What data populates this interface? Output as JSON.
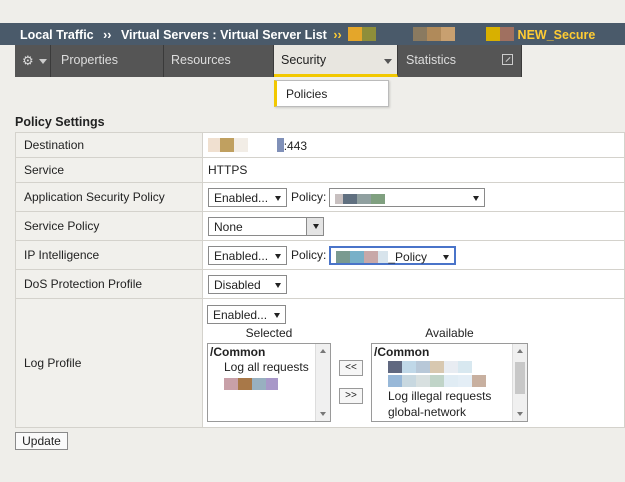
{
  "breadcrumb": {
    "part1": "Local Traffic",
    "sep1": "››",
    "part2": "Virtual Servers : Virtual Server List",
    "sep2": "››",
    "final_suffix": "NEW_Secure"
  },
  "tabs": {
    "gear_icon": "gear-icon",
    "properties": "Properties",
    "resources": "Resources",
    "security": "Security",
    "statistics": "Statistics"
  },
  "dropdown": {
    "policies": "Policies"
  },
  "section_title": "Policy Settings",
  "rows": {
    "destination": {
      "label": "Destination",
      "value_suffix": ":443"
    },
    "service": {
      "label": "Service",
      "value": "HTTPS"
    },
    "asp": {
      "label": "Application Security Policy",
      "state": "Enabled...",
      "policy_label": "Policy:"
    },
    "service_policy": {
      "label": "Service Policy",
      "value": "None"
    },
    "ip_intel": {
      "label": "IP Intelligence",
      "state": "Enabled...",
      "policy_label": "Policy:",
      "policy_suffix": "_Policy"
    },
    "dos": {
      "label": "DoS Protection Profile",
      "value": "Disabled"
    },
    "log_profile": {
      "label": "Log Profile",
      "state": "Enabled...",
      "selected_header": "Selected",
      "available_header": "Available",
      "selected_items": [
        "/Common",
        "Log all requests"
      ],
      "available_items": [
        "/Common",
        "Log illegal requests",
        "global-network"
      ],
      "move_left": "<<",
      "move_right": ">>"
    }
  },
  "update_button": "Update",
  "colors": {
    "header_bg": "#4a5a6a",
    "accent_yellow": "#f2c800",
    "tab_bg": "#555555",
    "focus_blue": "#4a74c9"
  }
}
